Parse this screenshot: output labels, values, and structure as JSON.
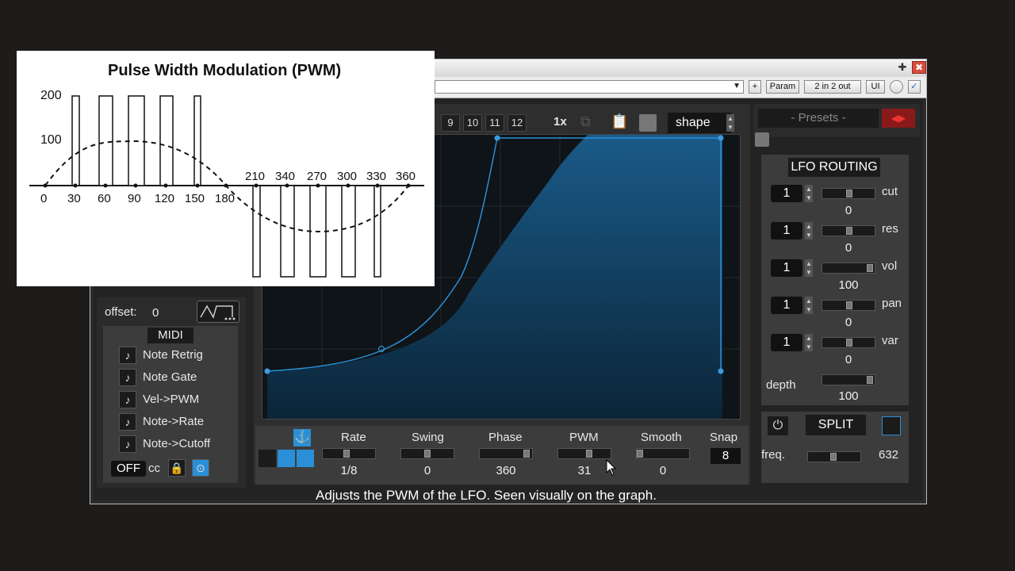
{
  "toolbar": {
    "plus": "+",
    "param": "Param",
    "io": "2 in 2 out",
    "ui": "UI",
    "check": "✓"
  },
  "title_controls": {
    "pin": "✚",
    "close": "✖"
  },
  "graph_header": {
    "pages": [
      "9",
      "10",
      "11",
      "12"
    ],
    "zoom": "1x",
    "shape": "shape"
  },
  "presets": {
    "label": "- Presets -"
  },
  "left": {
    "offset_label": "offset:",
    "offset_value": "0",
    "midi_title": "MIDI",
    "midi_items": [
      "Note Retrig",
      "Note Gate",
      "Vel->PWM",
      "Note->Rate",
      "Note->Cutoff"
    ],
    "off_label": "OFF",
    "cc_label": "cc"
  },
  "params": {
    "rate": {
      "label": "Rate",
      "value": "1/8",
      "level": 0.45
    },
    "swing": {
      "label": "Swing",
      "value": "0",
      "level": 0.5
    },
    "phase": {
      "label": "Phase",
      "value": "360",
      "level": 0.95
    },
    "pwm": {
      "label": "PWM",
      "value": "31",
      "level": 0.6
    },
    "smooth": {
      "label": "Smooth",
      "value": "0",
      "level": 0.0
    },
    "snap": {
      "label": "Snap",
      "value": "8"
    }
  },
  "routing": {
    "title": "LFO ROUTING",
    "rows": [
      {
        "num": "1",
        "target": "cut",
        "value": "0"
      },
      {
        "num": "1",
        "target": "res",
        "value": "0"
      },
      {
        "num": "1",
        "target": "vol",
        "value": "100"
      },
      {
        "num": "1",
        "target": "pan",
        "value": "0"
      },
      {
        "num": "1",
        "target": "var",
        "value": "0"
      }
    ],
    "depth_label": "depth",
    "depth_value": "100"
  },
  "split": {
    "label": "SPLIT",
    "freq_label": "freq.",
    "freq_value": "632"
  },
  "status": "Adjusts the PWM of the LFO.  Seen visually on the graph.",
  "figure": {
    "title": "Pulse Width Modulation (PWM)",
    "y_ticks": [
      "200",
      "100"
    ],
    "x_ticks_low": [
      "0",
      "30",
      "60",
      "90",
      "120",
      "150",
      "180"
    ],
    "x_ticks_high": [
      "210",
      "340",
      "270",
      "300",
      "330",
      "360"
    ]
  },
  "colors": {
    "accent": "#2a8fd6",
    "panel": "#3c3c3c",
    "fill": "#0f3a58"
  }
}
